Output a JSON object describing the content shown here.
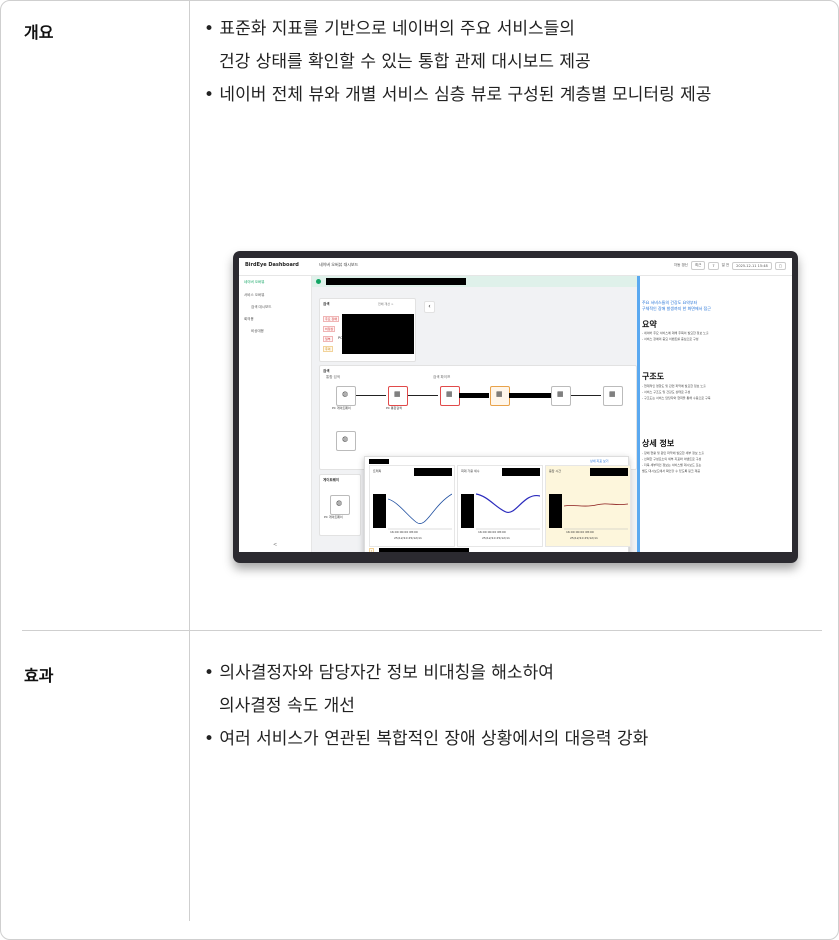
{
  "sections": [
    {
      "label": "개요",
      "bullets": [
        [
          "• 표준화 지표를 기반으로 네이버의 주요 서비스들의",
          "건강 상태를 확인할 수 있는 통합 관제 대시보드 제공"
        ],
        [
          "• 네이버 전체 뷰와 개별 서비스 심층 뷰로 구성된 계층별 모니터링 제공"
        ]
      ]
    },
    {
      "label": "효과",
      "bullets": [
        [
          "• 의사결정자와 담당자간 정보 비대칭을 해소하여",
          "의사결정 속도 개선"
        ],
        [
          "• 여러 서비스가 연관된 복합적인 장애 상황에서의 대응력 강화"
        ]
      ]
    }
  ],
  "screenshot": {
    "brand": "BirdEye Dashboard",
    "dashboard_title": "네이버 오버뷰 대시보드",
    "topbar": {
      "auto_refresh": "자동 갱신",
      "range_label": "최근",
      "range_value": "7",
      "range_unit": "일 전",
      "datetime": "2025-12-11 15:48"
    },
    "sidebar": [
      "네이버 오버뷰",
      "서비스 오버뷰",
      "검색 대시보드",
      "회의용",
      "비상대응"
    ],
    "search_card_title": "검색",
    "search_card_link": "전체 개선 >",
    "search_card_tags": [
      "주요 장애",
      "비정상",
      "일부",
      "주의"
    ],
    "search_card_item": "PC",
    "flow_title": "검색",
    "flow_subtitle": "통합 검색",
    "flow_subtitle2": "검색 파이프",
    "nodes": [
      "PC 게이트웨이",
      "PC 통합검색"
    ],
    "popup_link": "상세 지표 보기",
    "popup_cards": [
      "트래픽",
      "최대 가용 세수",
      "응답 시간"
    ],
    "popup_times": "16:00   00:00   08:00",
    "popup_dates": "25/12/10  25/12/11",
    "lower_card_title": "게이트웨이",
    "lower_card_sub": "PC 게이트웨이",
    "right_panel": {
      "intro": [
        "주요 서비스들의 건강도 요약부터",
        "구체적인 장애 발생까지 한 화면에서 접근"
      ],
      "sections": [
        {
          "title": "요약",
          "lines": [
            "- 네이버 주요 서비스에 대해 주목이 필요한 정보 노출",
            "- 서비스 장애의 중요 이벤트를 중심으로 구성"
          ]
        },
        {
          "title": "구조도",
          "lines": [
            "- 현재적인 영향도 및 관련 파악에 필요한 정보 노출",
            "- 서비스 구조도 및 건강도 상태로 구성",
            "- 구조도는 서비스 담당자와 협력을 통해 수동으로 구축"
          ]
        },
        {
          "title": "상세 정보",
          "lines": [
            "- 장애 현황 및 원인 파악에 필요한 세부 정보 노출",
            "- 선택한 구성요소의 세부 지표와 이벤트로 구성",
            "- 더욱 세부적인 정보는 서비스별 대시보드 또는",
            "  별도 대시보드에서 확인할 수 있도록 링크 제공"
          ]
        }
      ]
    },
    "footer": "항목에 마우스를 올리면 정보가 표시됩니다.",
    "collapse": "<",
    "accent_green": "#12a564",
    "accent_blue": "#1f6fd6"
  }
}
